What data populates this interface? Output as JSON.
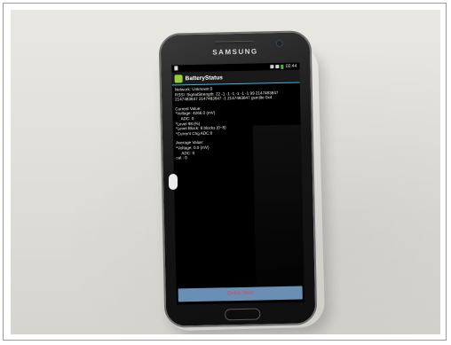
{
  "device": {
    "brand": "SAMSUNG",
    "status_time": "02:44"
  },
  "app": {
    "title": "BatteryStatus",
    "lines": [
      "Network: Unknown:0",
      "RSSI: SignalStrength: 22 -1 -1 -1 -1 -1 -1 99 2147483647",
      "2147483647 2147483647 -1 2147483647 gsm|lte 0x4"
    ],
    "current_label": "Current Value:",
    "current": [
      "*Voltage: 4266.0 (mV)",
      "ADC: 0",
      "*Level 98 (%)",
      "*Level Block: 8 blocks (0~8)",
      "*Current Chg ADC:0"
    ],
    "average_label": "Average Value:",
    "average": [
      "*Voltage: 0.0 (mV)",
      "ADC: 0",
      "cal : 0"
    ],
    "button_label": "Quick Start"
  }
}
